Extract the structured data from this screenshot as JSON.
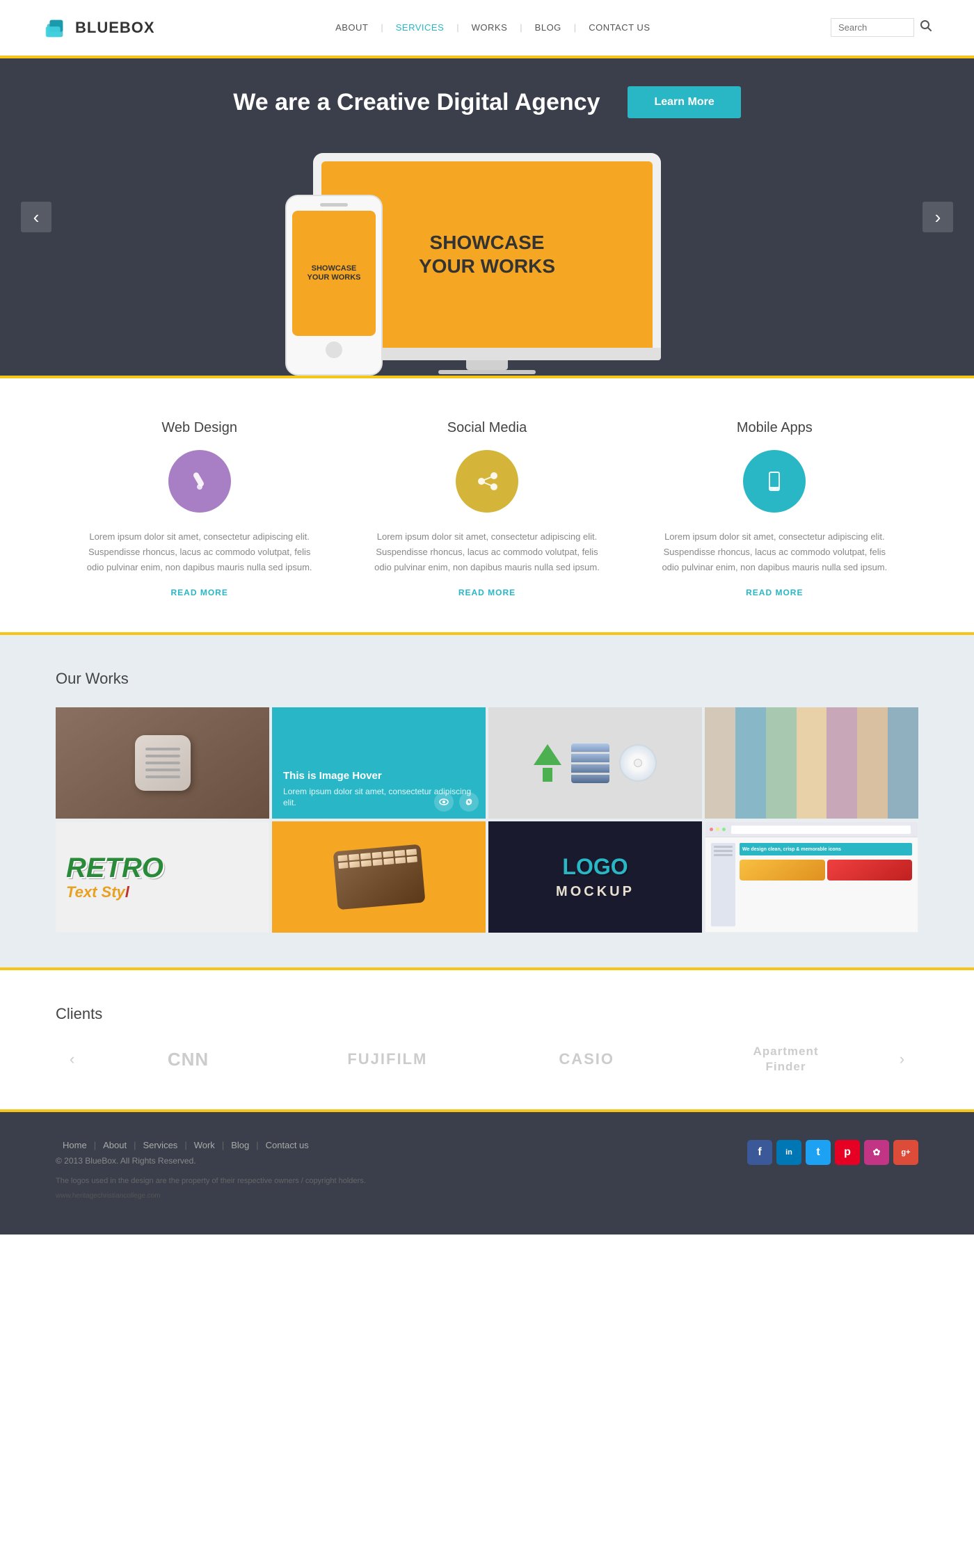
{
  "header": {
    "logo_text": "BLUEBOX",
    "nav_items": [
      {
        "label": "ABOUT",
        "active": false
      },
      {
        "label": "SERVICES",
        "active": true
      },
      {
        "label": "WORKS",
        "active": false
      },
      {
        "label": "BLOG",
        "active": false
      },
      {
        "label": "CONTACT US",
        "active": false
      }
    ],
    "search_placeholder": "Search"
  },
  "hero": {
    "tagline": "We are a Creative Digital Agency",
    "btn_label": "Learn More",
    "device_text_laptop": "SHOWCASE\nYOUR WORKS",
    "device_text_phone": "SHOWCASE\nYOUR WORKS",
    "arrow_left": "‹",
    "arrow_right": "›"
  },
  "services": {
    "items": [
      {
        "title": "Web Design",
        "icon_type": "purple",
        "icon_symbol": "✏",
        "text": "Lorem ipsum dolor sit amet, consectetur adipiscing elit. Suspendisse rhoncus, lacus ac commodo volutpat, felis odio pulvinar enim, non dapibus mauris nulla sed ipsum.",
        "read_more": "READ MORE"
      },
      {
        "title": "Social Media",
        "icon_type": "yellow",
        "icon_symbol": "⇅",
        "text": "Lorem ipsum dolor sit amet, consectetur adipiscing elit. Suspendisse rhoncus, lacus ac commodo volutpat, felis odio pulvinar enim, non dapibus mauris nulla sed ipsum.",
        "read_more": "READ MORE"
      },
      {
        "title": "Mobile Apps",
        "icon_type": "teal",
        "icon_symbol": "📱",
        "text": "Lorem ipsum dolor sit amet, consectetur adipiscing elit. Suspendisse rhoncus, lacus ac commodo volutpat, felis odio pulvinar enim, non dapibus mauris nulla sed ipsum.",
        "read_more": "READ MORE"
      }
    ]
  },
  "our_works": {
    "title": "Our Works",
    "hover_title": "This is Image Hover",
    "hover_desc": "Lorem ipsum dolor sit amet, consectetur adipiscing elit.",
    "items": [
      {
        "type": "notebook"
      },
      {
        "type": "hover-overlay"
      },
      {
        "type": "database"
      },
      {
        "type": "colorstrips"
      },
      {
        "type": "retro"
      },
      {
        "type": "keyboard"
      },
      {
        "type": "logomockup"
      },
      {
        "type": "websitescreenshot"
      }
    ]
  },
  "clients": {
    "title": "Clients",
    "logos": [
      "CNN",
      "FUJIFILM",
      "CASIO",
      "Apartment Finder"
    ],
    "arrow_left": "‹",
    "arrow_right": "›"
  },
  "footer": {
    "nav_links": [
      "Home",
      "About",
      "Services",
      "Work",
      "Blog",
      "Contact us"
    ],
    "copyright": "© 2013 BlueBox.  All Rights Reserved.",
    "disclaimer": "The logos used in the design are the property of their respective owners / copyright holders.",
    "url": "www.heritagechristiancollege.com",
    "social_links": [
      "f",
      "in",
      "t",
      "p",
      "♦",
      "g+"
    ]
  },
  "colors": {
    "accent": "#29b6c5",
    "gold": "#f5c518",
    "dark_bg": "#3a3f4b"
  }
}
